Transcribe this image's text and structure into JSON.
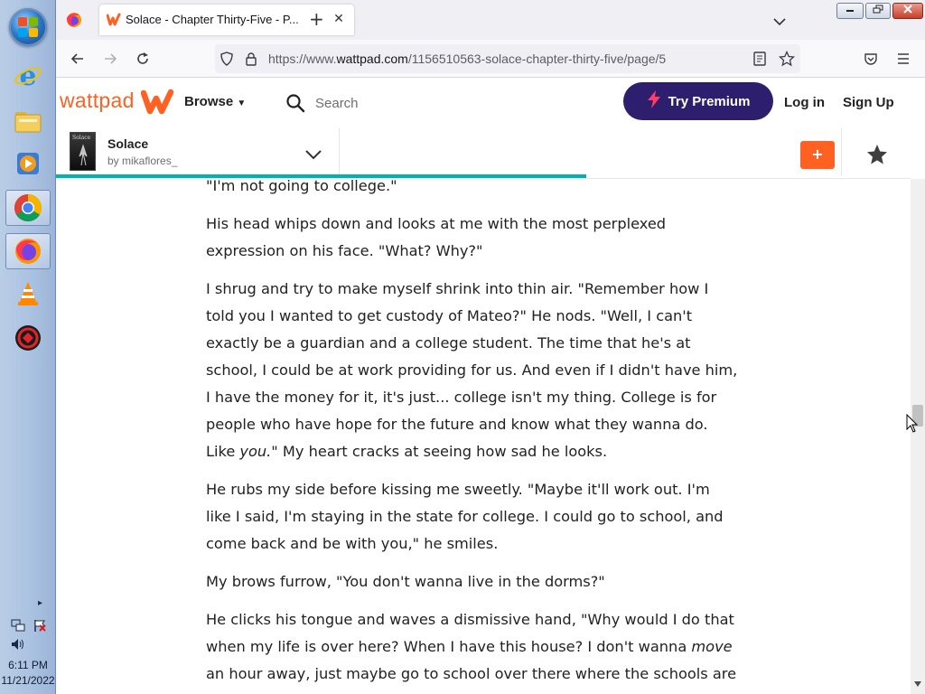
{
  "taskbar": {
    "items": [
      {
        "icon": "internet-explorer-icon"
      },
      {
        "icon": "file-explorer-icon"
      },
      {
        "icon": "media-player-icon"
      },
      {
        "icon": "chrome-icon"
      },
      {
        "icon": "firefox-icon"
      },
      {
        "icon": "vlc-icon"
      },
      {
        "icon": "app-icon"
      }
    ],
    "time": "6:11 PM",
    "date": "11/21/2022"
  },
  "browser": {
    "tab_title": "Solace - Chapter Thirty-Five - P...",
    "url_prefix": "https://www.",
    "url_domain": "wattpad.com",
    "url_path": "/1156510563-solace-chapter-thirty-five/page/5"
  },
  "site": {
    "logo": "wattpad",
    "browse": "Browse",
    "search_placeholder": "Search",
    "premium": "Try Premium",
    "login": "Log in",
    "signup": "Sign Up"
  },
  "story": {
    "title": "Solace",
    "author": "by mikaflores_",
    "cover_text": "Solace",
    "reading_progress": 0.62,
    "add_label": "+"
  },
  "content": {
    "p1": "\"I'm not going to college.\"",
    "p2": "His head whips down and looks at me with the most perplexed expression on his face. \"What? Why?\"",
    "p3a": "I shrug and try to make myself shrink into thin air. \"Remember how I told you I wanted to get custody of Mateo?\" He nods. \"Well, I can't exactly be a guardian and a college student. The time that he's at school, I could be at work providing for us. And even if I didn't have him, I have the money for it, it's just... college isn't my thing. College is for people who have hope for the future and know what they wanna do. Like ",
    "p3em": "you.\"",
    "p3b": " My heart cracks at seeing how sad he looks.",
    "p4": "He rubs my side before kissing me sweetly. \"Maybe it'll work out. I'm like I said, I'm staying in the state for college. I could go to school, and come back and be with you,\" he smiles.",
    "p5": "My brows furrow, \"You don't wanna live in the dorms?\"",
    "p6a": "He clicks his tongue and waves a dismissive hand, \"Why would I do that when my life is over here? When I have this house? I don't wanna ",
    "p6em": "move",
    "p6b": " an hour away, just maybe go to school over there where the schools are a bit"
  },
  "colors": {
    "brand": "#ff6122",
    "premium": "#2e1e6e",
    "progress": "#00b2b2"
  }
}
